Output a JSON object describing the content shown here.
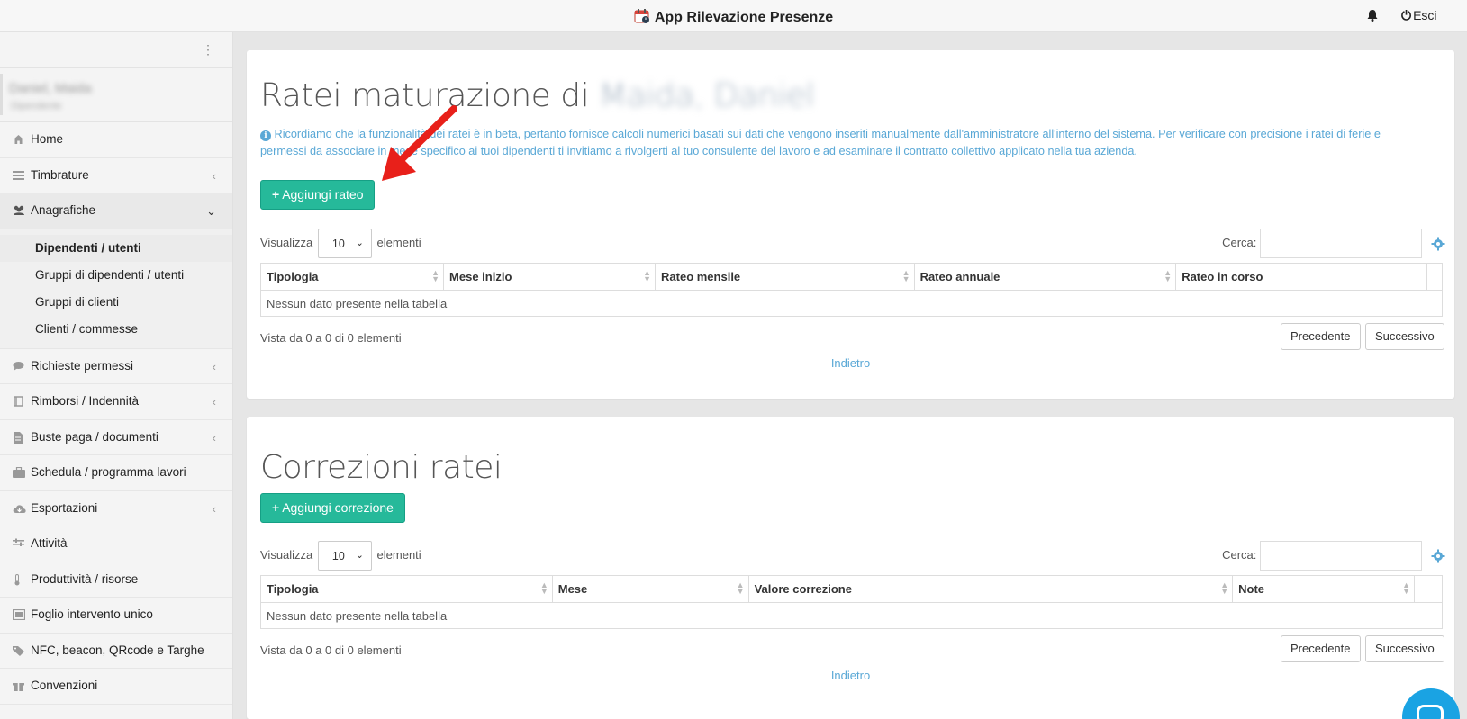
{
  "header": {
    "app_title": "App Rilevazione Presenze",
    "logout_label": "Esci"
  },
  "sidebar": {
    "user_name": "Daniel, Maida",
    "user_role": "Dipendente",
    "items": [
      {
        "label": "Home",
        "icon": "home-icon"
      },
      {
        "label": "Timbrature",
        "icon": "list-icon"
      },
      {
        "label": "Anagrafiche",
        "icon": "users-icon"
      },
      {
        "label": "Richieste permessi",
        "icon": "comment-icon"
      },
      {
        "label": "Rimborsi / Indennità",
        "icon": "book-icon"
      },
      {
        "label": "Buste paga / documenti",
        "icon": "file-icon"
      },
      {
        "label": "Schedula / programma lavori",
        "icon": "briefcase-icon"
      },
      {
        "label": "Esportazioni",
        "icon": "cloud-download-icon"
      },
      {
        "label": "Attività",
        "icon": "tasks-icon"
      },
      {
        "label": "Produttività / risorse",
        "icon": "thermometer-icon"
      },
      {
        "label": "Foglio intervento unico",
        "icon": "frame-icon"
      },
      {
        "label": "NFC, beacon, QRcode e Targhe",
        "icon": "tags-icon"
      },
      {
        "label": "Convenzioni",
        "icon": "gift-icon"
      }
    ],
    "submenu": [
      {
        "label": "Dipendenti / utenti"
      },
      {
        "label": "Gruppi di dipendenti / utenti"
      },
      {
        "label": "Gruppi di clienti"
      },
      {
        "label": "Clienti / commesse"
      }
    ]
  },
  "ratei": {
    "title": "Ratei maturazione di",
    "title_name": "Maida, Daniel",
    "info_text": "Ricordiamo che la funzionalità dei ratei è in beta, pertanto fornisce calcoli numerici basati sui dati che vengono inseriti manualmente dall'amministratore all'interno del sistema. Per verificare con precisione i ratei di ferie e permessi da associare in mese specifico ai tuoi dipendenti ti invitiamo a rivolgerti al tuo consulente del lavoro e ad esaminare il contratto collettivo applicato nella tua azienda.",
    "add_button": "Aggiungi rateo",
    "show_label": "Visualizza",
    "page_length": "10",
    "elements_label": "elementi",
    "search_label": "Cerca:",
    "columns": [
      "Tipologia",
      "Mese inizio",
      "Rateo mensile",
      "Rateo annuale",
      "Rateo in corso"
    ],
    "empty_text": "Nessun dato presente nella tabella",
    "summary": "Vista da 0 a 0 di 0 elementi",
    "prev": "Precedente",
    "next": "Successivo",
    "back": "Indietro"
  },
  "correzioni": {
    "title": "Correzioni ratei",
    "add_button": "Aggiungi correzione",
    "show_label": "Visualizza",
    "page_length": "10",
    "elements_label": "elementi",
    "search_label": "Cerca:",
    "columns": [
      "Tipologia",
      "Mese",
      "Valore correzione",
      "Note"
    ],
    "empty_text": "Nessun dato presente nella tabella",
    "summary": "Vista da 0 a 0 di 0 elementi",
    "prev": "Precedente",
    "next": "Successivo",
    "back": "Indietro"
  },
  "colors": {
    "accent": "#26b99a",
    "info": "#5aa8d6",
    "arrow": "#e8201a"
  }
}
